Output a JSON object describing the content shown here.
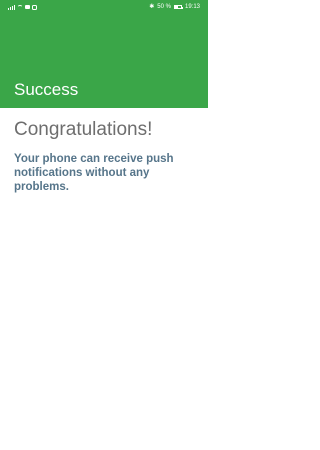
{
  "status_bar": {
    "battery": "50 %",
    "time": "19:13",
    "icons": [
      "signal-icon",
      "wifi-icon",
      "message-icon",
      "instagram-icon",
      "bluetooth-icon",
      "battery-icon"
    ]
  },
  "header": {
    "title": "Success",
    "color": "#3aa648"
  },
  "main": {
    "heading": "Congratulations!",
    "message": "Your phone can receive push notifications without any problems."
  }
}
